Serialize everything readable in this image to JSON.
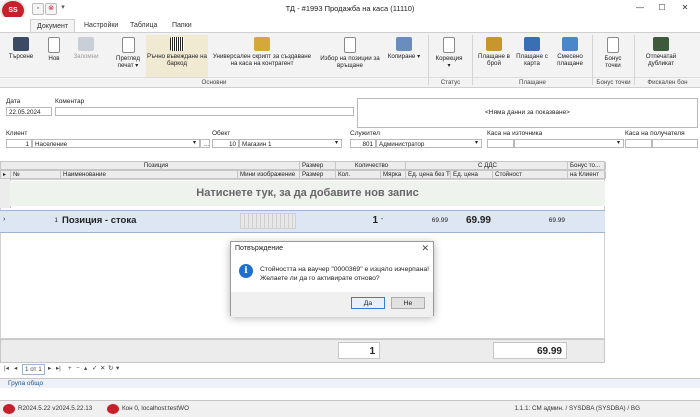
{
  "app": {
    "logo_text": "SS",
    "title": "ТД - #1993 Продажба на каса (11110)",
    "window_controls": [
      "minimize-icon",
      "maximize-icon",
      "close-icon"
    ]
  },
  "tabs": [
    {
      "label": "Документ",
      "active": true
    },
    {
      "label": "Настройки",
      "active": false
    },
    {
      "label": "Таблица",
      "active": false
    },
    {
      "label": "Папки",
      "active": false
    }
  ],
  "ribbon": {
    "buttons": [
      {
        "label": "Търсене",
        "icon": "binoculars-icon",
        "enabled": true
      },
      {
        "label": "Нов",
        "icon": "new-document-icon",
        "enabled": true
      },
      {
        "label": "Запомни",
        "icon": "save-icon",
        "enabled": false
      },
      {
        "label": "Преглед печат",
        "icon": "print-preview-icon",
        "enabled": true,
        "dropdown": true
      },
      {
        "label": "Ръчно въвеждане на баркод",
        "icon": "barcode-icon",
        "enabled": true
      },
      {
        "label": "Универсален скрипт за създаване на каса на контрагент",
        "icon": "script-icon",
        "enabled": true
      },
      {
        "label": "Избор на позиции за връщане",
        "icon": "return-items-icon",
        "enabled": true
      },
      {
        "label": "Копиране",
        "icon": "copy-icon",
        "enabled": true,
        "dropdown": true
      },
      {
        "label": "Корекция",
        "icon": "correction-icon",
        "enabled": true,
        "dropdown": true
      },
      {
        "label": "Плащане в брой",
        "icon": "cash-payment-icon",
        "enabled": true
      },
      {
        "label": "Плащане с карта",
        "icon": "card-payment-icon",
        "enabled": true
      },
      {
        "label": "Смесено плащане",
        "icon": "mixed-payment-icon",
        "enabled": true
      },
      {
        "label": "Бонус точки",
        "icon": "bonus-points-icon",
        "enabled": true
      },
      {
        "label": "Отпечатай дубликат",
        "icon": "fiscal-printer-icon",
        "enabled": true
      }
    ],
    "groups": [
      "Основни",
      "Статус",
      "Плащане",
      "Бонус точки",
      "Фискален бон"
    ]
  },
  "form": {
    "date_label": "Дата",
    "date_value": "22.05.2024",
    "comment_label": "Коментар",
    "comment_value": "",
    "info_text": "<Няма данни за показване>",
    "client_label": "Клиент",
    "client_code": "1",
    "client_name": "Население",
    "object_label": "Обект",
    "object_code": "10",
    "object_name": "Магазин 1",
    "employee_label": "Служител",
    "employee_code": "801",
    "employee_name": "Администратор",
    "source_cash_label": "Каса на източника",
    "source_cash_value": "",
    "recipient_cash_label": "Каса на получателя",
    "recipient_cash_value": ""
  },
  "grid": {
    "group_headers": [
      "Позиция",
      "Размер",
      "Количество",
      "С ДДС",
      "Бонус то..."
    ],
    "columns": [
      "№",
      "Наименование",
      "Мини изображение",
      "Размер",
      "Кол.",
      "Мярка",
      "Ед. цена без ТО",
      "Ед. цена",
      "Стойност",
      "на Клиент"
    ],
    "add_row_text": "Натиснете тук, за да добавите нов запис",
    "rows": [
      {
        "no": "1",
        "name": "Позиция - стока",
        "size": "",
        "qty": "1",
        "unit": "-",
        "price_no_to": "69.99",
        "price": "69.99",
        "value": "69.99",
        "bonus": ""
      }
    ],
    "totals": {
      "qty": "1",
      "value": "69.99"
    }
  },
  "navigator": {
    "page_text": "1 от 1"
  },
  "group_bar": "Група общо",
  "status_bar": {
    "version": "R2024.5.22 v2024.5.22.13",
    "connection": "Кон 0, localhost:testWO",
    "right": "1.1.1: СМ админ. / SYSDBA (SYSDBA) / BG"
  },
  "dialog": {
    "title": "Потвърждение",
    "icon": "info-icon",
    "message_line1": "Стойността на ваучер \"0000369\" е изцяло изчерпана!",
    "message_line2": "Желаете ли да го активирате отново?",
    "yes_label": "Да",
    "no_label": "Не"
  }
}
